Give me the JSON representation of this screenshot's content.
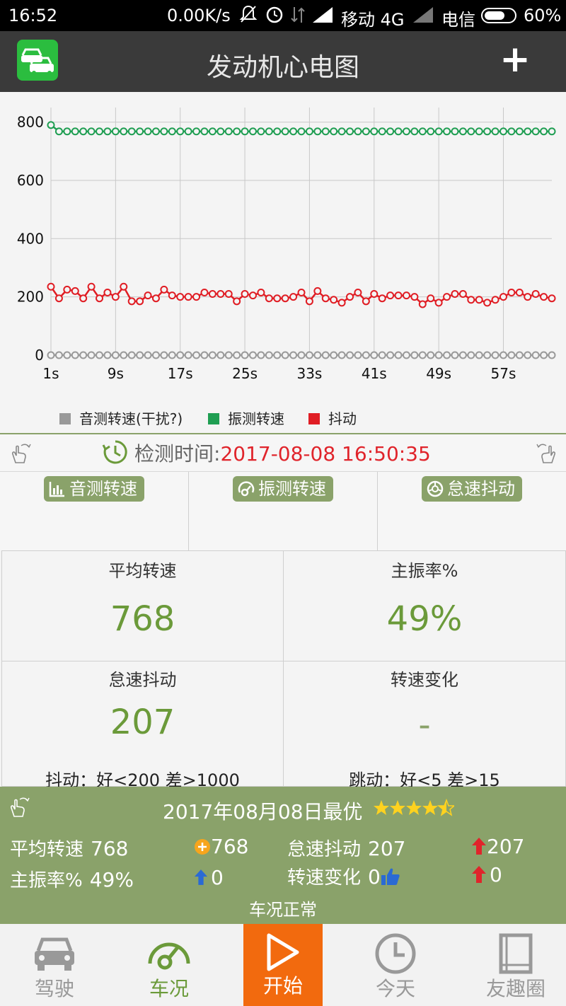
{
  "status_bar": {
    "time": "16:52",
    "speed": "0.00K/s",
    "carrier1": "移动 4G",
    "carrier2": "电信",
    "battery": "60%"
  },
  "header": {
    "title": "发动机心电图",
    "plus_label": "+"
  },
  "chart_data": {
    "type": "line",
    "x_tick_labels": [
      "1s",
      "9s",
      "17s",
      "25s",
      "33s",
      "41s",
      "49s",
      "57s"
    ],
    "y_tick_labels": [
      "0",
      "200",
      "400",
      "600",
      "800"
    ],
    "ylim": [
      0,
      850
    ],
    "grid": true,
    "legend_position": "bottom",
    "x": [
      1,
      2,
      3,
      4,
      5,
      6,
      7,
      8,
      9,
      10,
      11,
      12,
      13,
      14,
      15,
      16,
      17,
      18,
      19,
      20,
      21,
      22,
      23,
      24,
      25,
      26,
      27,
      28,
      29,
      30,
      31,
      32,
      33,
      34,
      35,
      36,
      37,
      38,
      39,
      40,
      41,
      42,
      43,
      44,
      45,
      46,
      47,
      48,
      49,
      50,
      51,
      52,
      53,
      54,
      55,
      56,
      57,
      58,
      59,
      60,
      61,
      62,
      63
    ],
    "series": [
      {
        "name": "音测转速(干扰?)",
        "color": "#999999",
        "values": [
          0,
          0,
          0,
          0,
          0,
          0,
          0,
          0,
          0,
          0,
          0,
          0,
          0,
          0,
          0,
          0,
          0,
          0,
          0,
          0,
          0,
          0,
          0,
          0,
          0,
          0,
          0,
          0,
          0,
          0,
          0,
          0,
          0,
          0,
          0,
          0,
          0,
          0,
          0,
          0,
          0,
          0,
          0,
          0,
          0,
          0,
          0,
          0,
          0,
          0,
          0,
          0,
          0,
          0,
          0,
          0,
          0,
          0,
          0,
          0,
          0,
          0,
          0
        ]
      },
      {
        "name": "振测转速",
        "color": "#1f9e52",
        "values": [
          790,
          768,
          768,
          768,
          768,
          768,
          768,
          768,
          768,
          768,
          768,
          768,
          768,
          768,
          768,
          768,
          768,
          768,
          768,
          768,
          768,
          768,
          768,
          768,
          768,
          768,
          768,
          768,
          768,
          768,
          768,
          768,
          768,
          768,
          768,
          768,
          768,
          768,
          768,
          768,
          768,
          768,
          768,
          768,
          768,
          768,
          768,
          768,
          768,
          768,
          768,
          768,
          768,
          768,
          768,
          768,
          768,
          768,
          768,
          768,
          768,
          768,
          768
        ]
      },
      {
        "name": "抖动",
        "color": "#e01d24",
        "values": [
          235,
          195,
          225,
          220,
          195,
          235,
          195,
          215,
          200,
          235,
          185,
          185,
          205,
          195,
          225,
          205,
          200,
          200,
          200,
          215,
          210,
          210,
          210,
          185,
          210,
          205,
          215,
          195,
          195,
          195,
          200,
          215,
          185,
          220,
          195,
          190,
          180,
          200,
          215,
          185,
          210,
          195,
          205,
          205,
          205,
          200,
          175,
          195,
          180,
          200,
          210,
          210,
          190,
          190,
          180,
          190,
          200,
          215,
          215,
          200,
          210,
          200,
          195
        ]
      }
    ]
  },
  "detect": {
    "label": "检测时间:",
    "time": "2017-08-08 16:50:35"
  },
  "tabs": [
    {
      "label": "音测转速",
      "icon": "bar-chart-icon"
    },
    {
      "label": "振测转速",
      "icon": "gauge-icon"
    },
    {
      "label": "怠速抖动",
      "icon": "wheel-icon"
    }
  ],
  "stats": {
    "avg_speed": {
      "title": "平均转速",
      "value": "768"
    },
    "main_vib": {
      "title": "主振率%",
      "value": "49%"
    },
    "idle_jitter": {
      "title": "怠速抖动",
      "value": "207",
      "note": "抖动：好<200  差>1000"
    },
    "speed_change": {
      "title": "转速变化",
      "value": "-",
      "note": "跳动：好<5  差>15"
    }
  },
  "summary": {
    "date_best": "2017年08月08日最优",
    "rating_stars": 4.5,
    "avg_speed_label": "平均转速",
    "avg_speed_value": "768",
    "avg_speed_best": "768",
    "main_vib_label": "主振率%",
    "main_vib_value": "49%",
    "main_vib_delta": "0",
    "idle_label": "怠速抖动",
    "idle_value": "207",
    "idle_delta": "207",
    "change_label": "转速变化",
    "change_value": "0",
    "change_delta": "0",
    "status": "车况正常"
  },
  "nav": {
    "drive": "驾驶",
    "condition": "车况",
    "start": "开始",
    "today": "今天",
    "circle": "友趣圈"
  },
  "colors": {
    "accent_green": "#8aa26a",
    "value_green": "#6b9a3a",
    "start_orange": "#f26a0e",
    "alert_red": "#e0242b"
  }
}
